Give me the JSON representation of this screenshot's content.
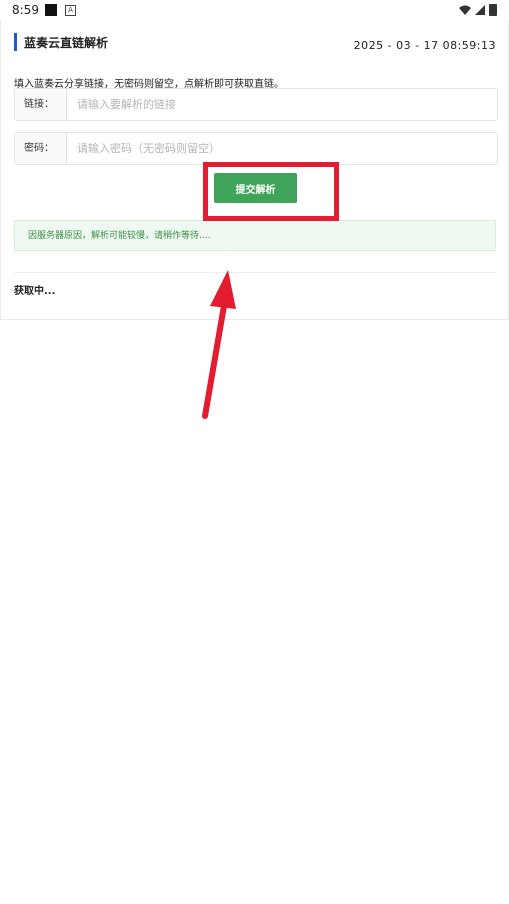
{
  "status_bar": {
    "time": "8:59"
  },
  "header": {
    "title": "蓝奏云直链解析",
    "datetime": "2025 - 03 - 17 08:59:13"
  },
  "instruction": "填入蓝奏云分享链接，无密码则留空，点解析即可获取直链。",
  "link_field": {
    "label": "链接：",
    "value": "",
    "placeholder": "请输入要解析的链接"
  },
  "password_field": {
    "label": "密码：",
    "value": "",
    "placeholder": "请输入密码（无密码则留空）"
  },
  "submit_label": "提交解析",
  "notice": "因服务器原因，解析可能较慢，请稍作等待....",
  "loading": "获取中...",
  "colors": {
    "accent": "#1e5bd6",
    "submit": "#3fa35a",
    "notice_bg": "#f0f9f1",
    "notice_text": "#3a8f48",
    "annotation": "#e31c2f"
  }
}
